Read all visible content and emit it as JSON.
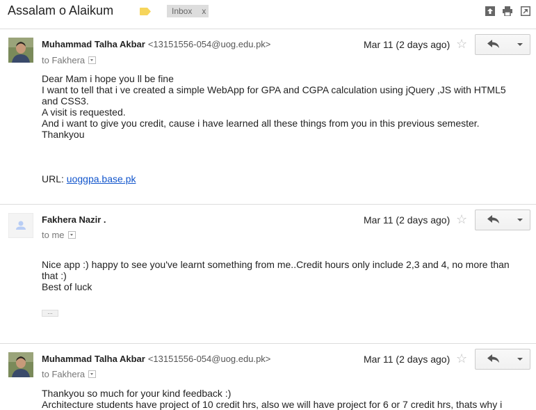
{
  "subject": "Assalam o Alaikum",
  "label": {
    "name": "Inbox",
    "remove": "x"
  },
  "colors": {
    "link": "#1155cc",
    "label_icon": "#f6d55c",
    "avatar_generic": "#b8cdf5"
  },
  "icons": [
    "tag-icon",
    "expand-all-icon",
    "print-icon",
    "new-window-icon",
    "reply-icon",
    "star-icon",
    "chevron-down-icon"
  ],
  "messages": [
    {
      "sender": "Muhammad Talha Akbar",
      "email": "<13151556-054@uog.edu.pk>",
      "to": "to Fakhera",
      "date": "Mar 11 (2 days ago)",
      "body": [
        "Dear Mam i hope you ll be fine",
        "I want to tell that i ve created a simple WebApp for GPA and CGPA calculation using jQuery ,JS with HTML5 and CSS3.",
        "A visit is requested.",
        "And i want to give you credit, cause i have learned all these things from you in this previous semester.",
        "Thankyou"
      ],
      "url_label": "URL: ",
      "url": "uoggpa.base.pk"
    },
    {
      "sender": "Fakhera Nazir .",
      "email": "",
      "to": "to me",
      "date": "Mar 11 (2 days ago)",
      "body": [
        "Nice app :) happy to see you've learnt something from me..Credit hours only include 2,3 and 4, no more than that :)",
        "Best of luck"
      ],
      "show_trimmed": "..."
    },
    {
      "sender": "Muhammad Talha Akbar",
      "email": "<13151556-054@uog.edu.pk>",
      "to": "to Fakhera",
      "date": "Mar 11 (2 days ago)",
      "body": [
        "Thankyou so much for your kind feedback :)",
        "Architecture students have project of 10 credit hrs, also we will have project for 6 or 7 credit hrs, thats why i"
      ]
    }
  ]
}
